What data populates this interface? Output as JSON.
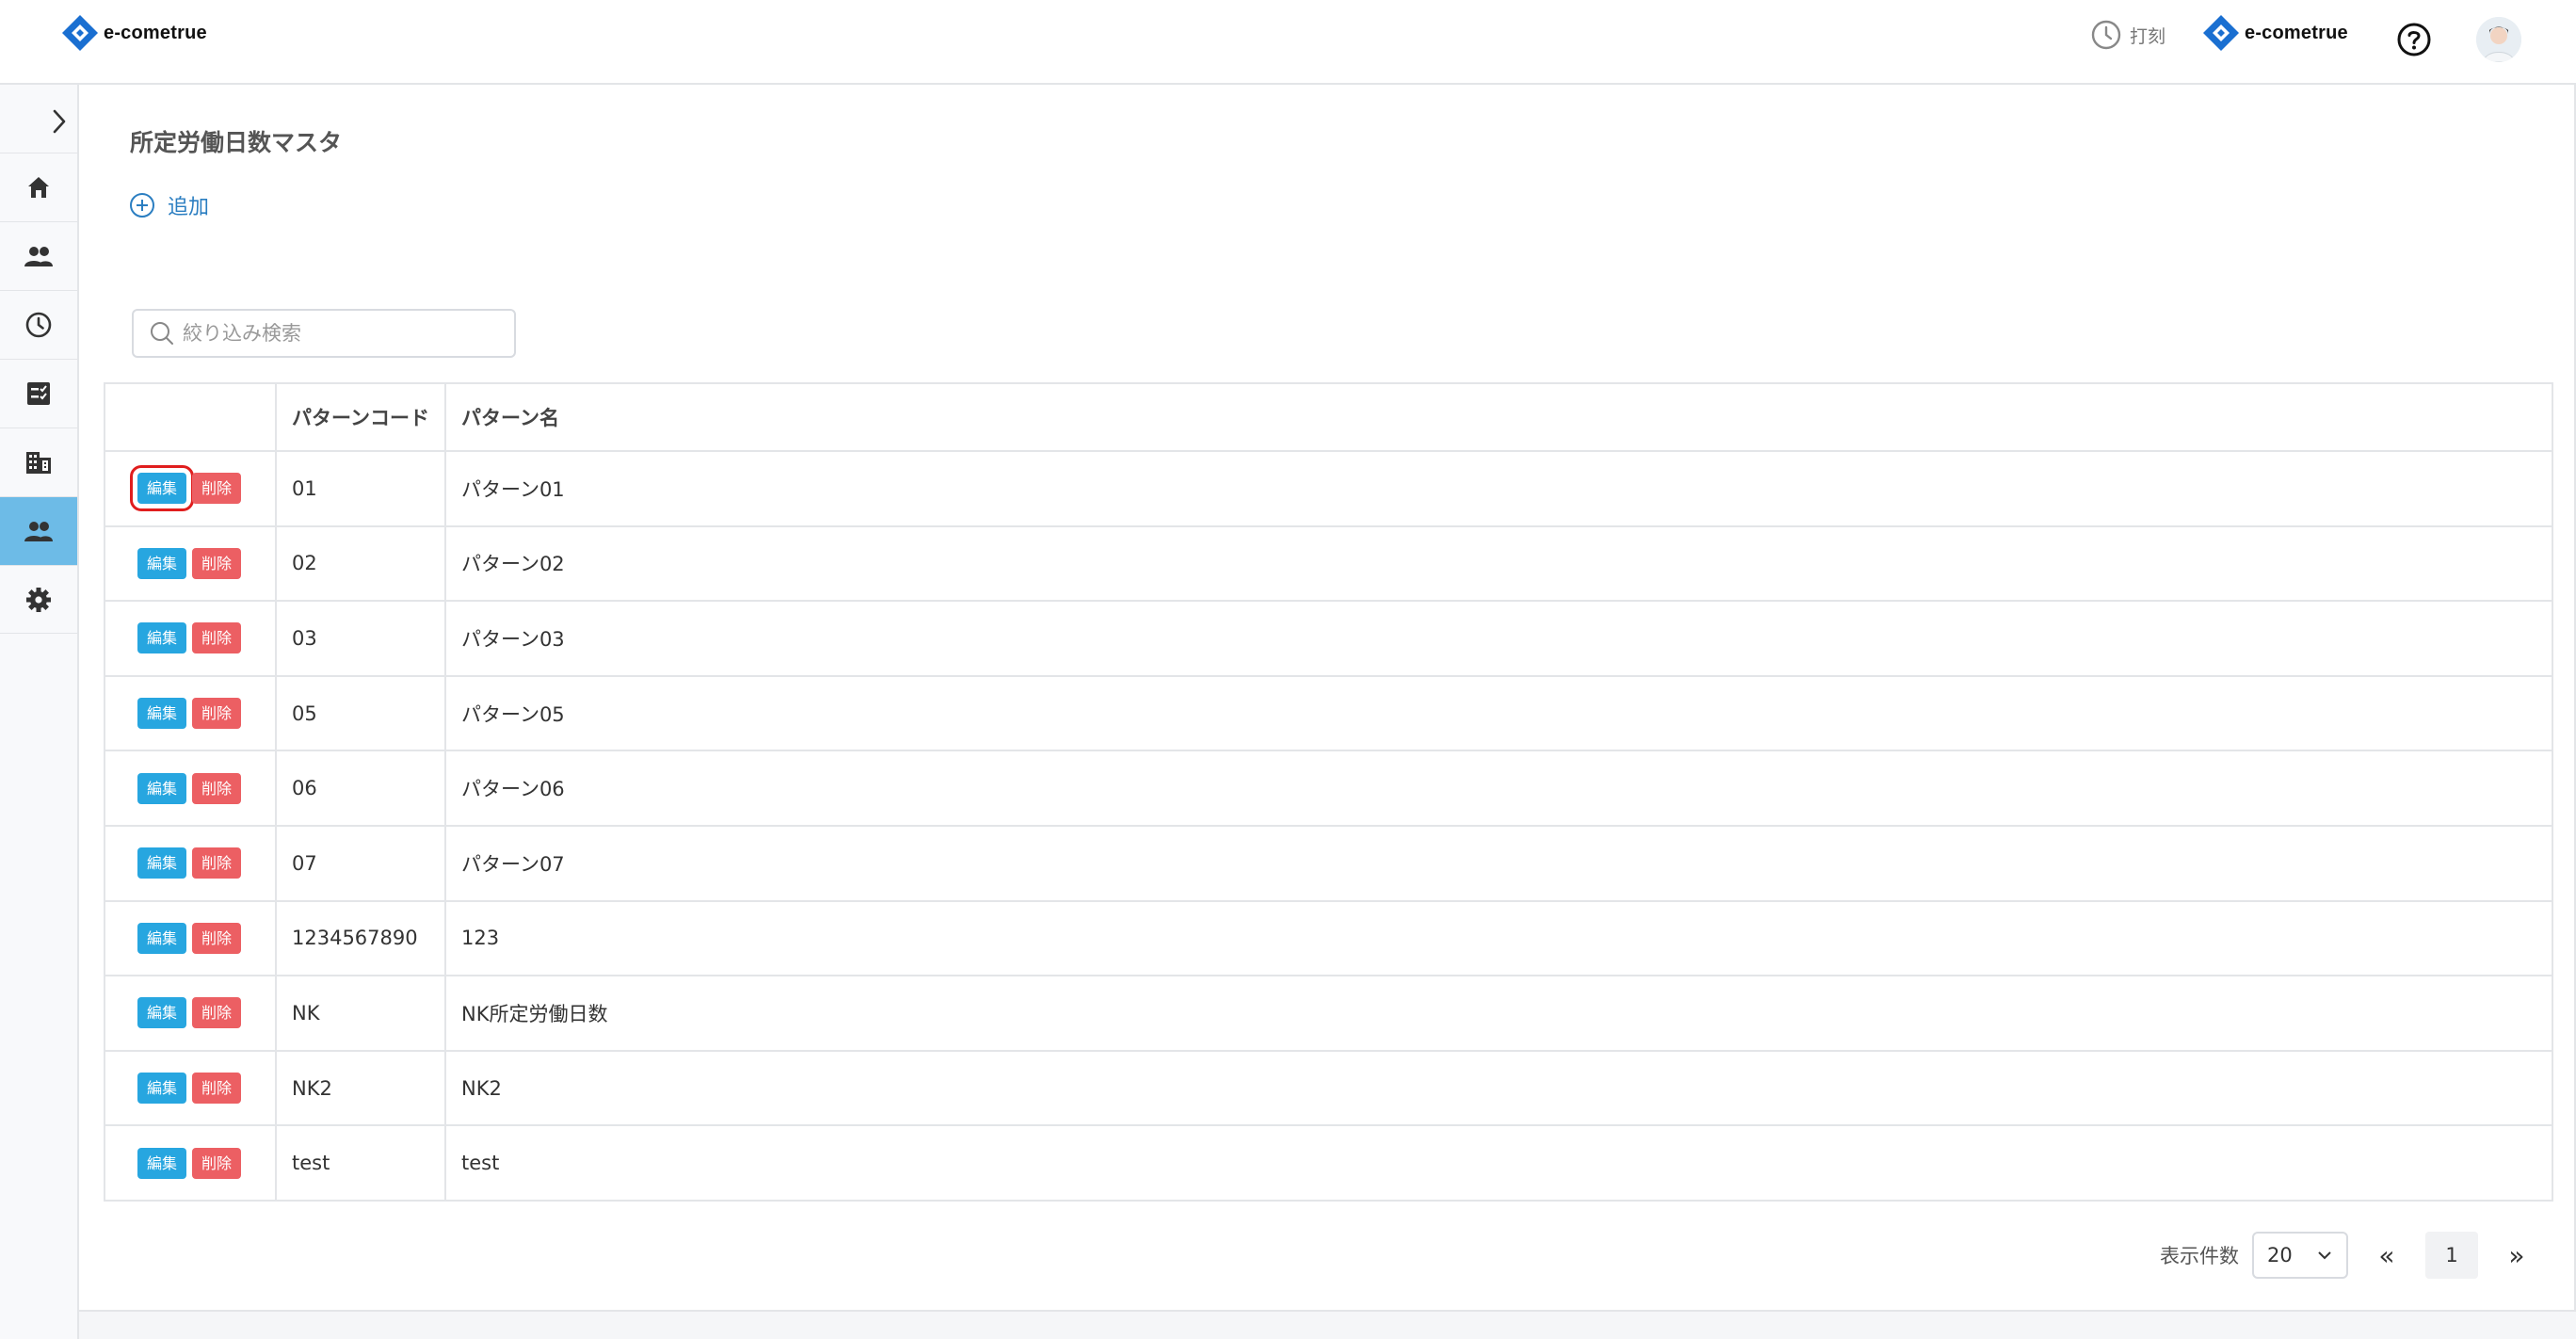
{
  "brand": {
    "name": "e-cometrue",
    "color": "#1a6fd1"
  },
  "header": {
    "punch_label": "打刻",
    "help_icon": "question-circle-icon",
    "avatar": "user-avatar"
  },
  "sidebar": {
    "toggle_icon": "chevron-right-icon",
    "items": [
      {
        "icon": "home-icon",
        "active": false
      },
      {
        "icon": "users-icon",
        "active": false
      },
      {
        "icon": "clock-icon",
        "active": false
      },
      {
        "icon": "checklist-icon",
        "active": false
      },
      {
        "icon": "building-icon",
        "active": false
      },
      {
        "icon": "users-icon",
        "active": true
      },
      {
        "icon": "gear-icon",
        "active": false
      }
    ],
    "active_color": "#6dbbe7"
  },
  "page": {
    "title": "所定労働日数マスタ",
    "add_label": "追加",
    "search_placeholder": "絞り込み検索"
  },
  "table": {
    "headers": [
      "",
      "パターンコード",
      "パターン名"
    ],
    "edit_label": "編集",
    "delete_label": "削除",
    "rows": [
      {
        "code": "01",
        "name": "パターン01"
      },
      {
        "code": "02",
        "name": "パターン02"
      },
      {
        "code": "03",
        "name": "パターン03"
      },
      {
        "code": "05",
        "name": "パターン05"
      },
      {
        "code": "06",
        "name": "パターン06"
      },
      {
        "code": "07",
        "name": "パターン07"
      },
      {
        "code": "1234567890",
        "name": "123"
      },
      {
        "code": "NK",
        "name": "NK所定労働日数"
      },
      {
        "code": "NK2",
        "name": "NK2"
      },
      {
        "code": "test",
        "name": "test"
      }
    ]
  },
  "pagination": {
    "per_page_label": "表示件数",
    "per_page_value": "20",
    "prev_label": "«",
    "next_label": "»",
    "current_page": "1"
  },
  "colors": {
    "edit": "#27a6e0",
    "delete": "#ec5f63",
    "highlight": "#e01e1e",
    "link": "#2b7ec1"
  }
}
